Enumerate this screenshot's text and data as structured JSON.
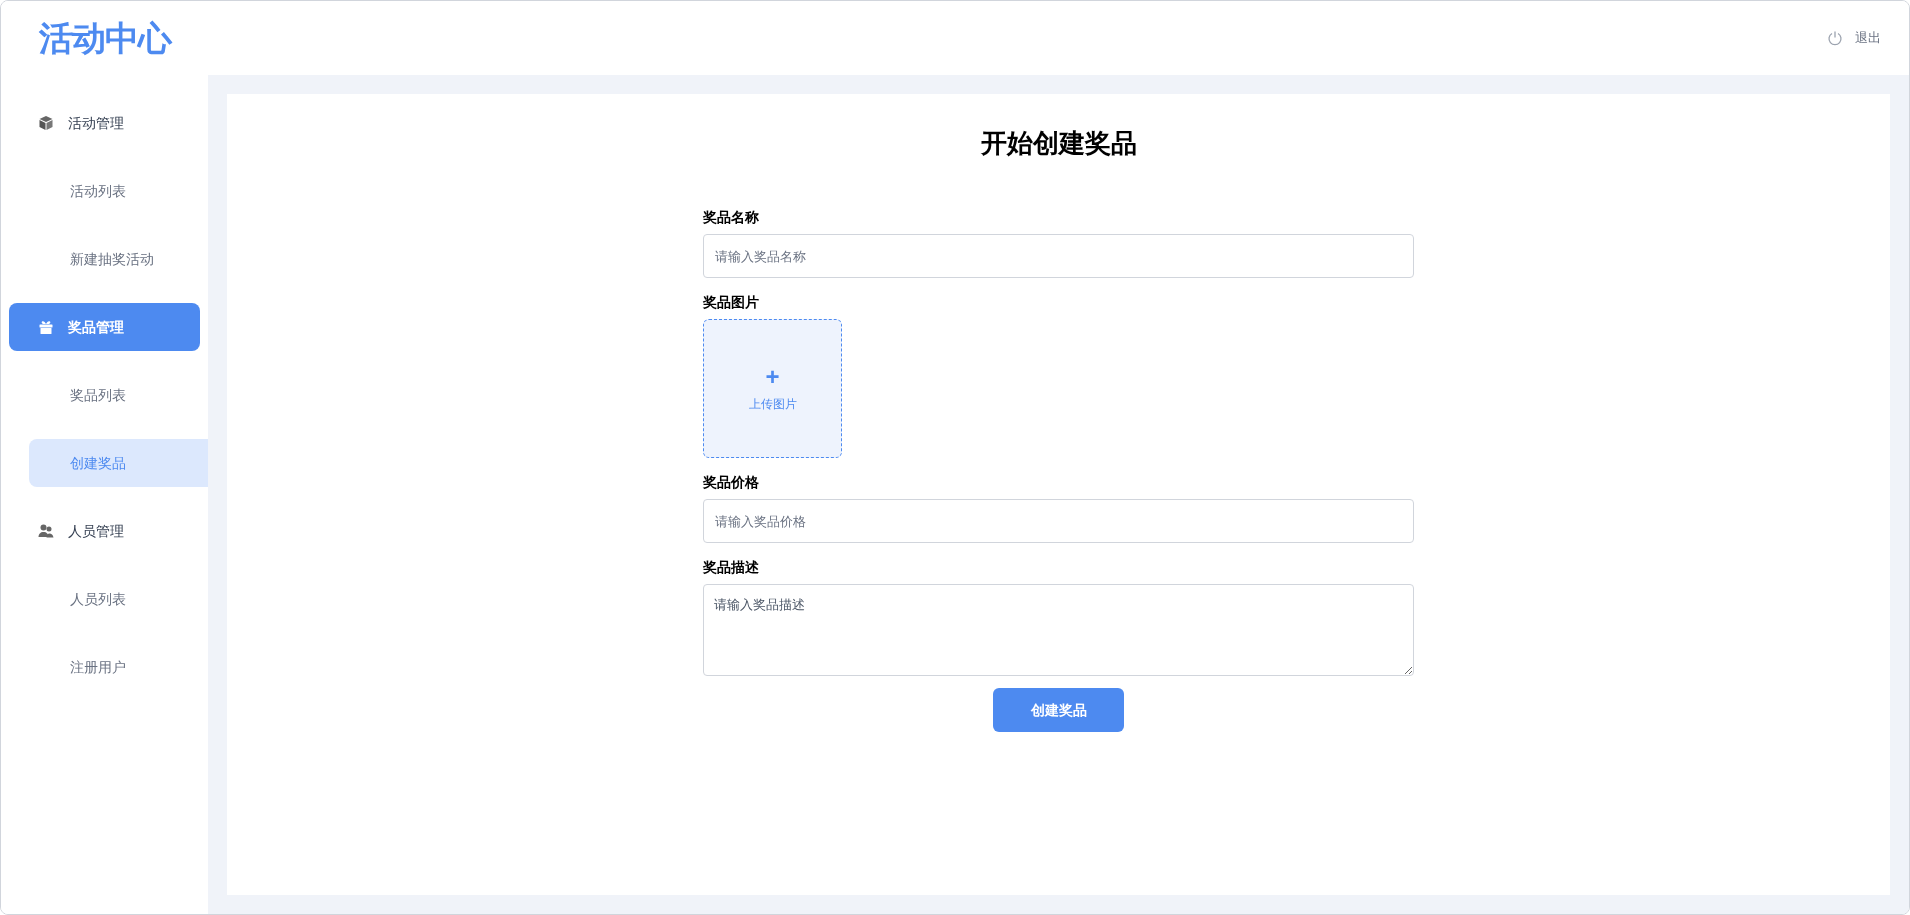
{
  "logo": "活动中心",
  "header": {
    "logout": "退出"
  },
  "sidebar": {
    "groups": [
      {
        "label": "活动管理",
        "selected": false,
        "children": [
          {
            "label": "活动列表",
            "selected": false
          },
          {
            "label": "新建抽奖活动",
            "selected": false
          }
        ]
      },
      {
        "label": "奖品管理",
        "selected": true,
        "children": [
          {
            "label": "奖品列表",
            "selected": false
          },
          {
            "label": "创建奖品",
            "selected": true
          }
        ]
      },
      {
        "label": "人员管理",
        "selected": false,
        "children": [
          {
            "label": "人员列表",
            "selected": false
          },
          {
            "label": "注册用户",
            "selected": false
          }
        ]
      }
    ]
  },
  "form": {
    "title": "开始创建奖品",
    "fields": [
      {
        "kind": "text",
        "label": "奖品名称",
        "placeholder": "请输入奖品名称"
      },
      {
        "kind": "upload",
        "label": "奖品图片",
        "icon": "+",
        "text": "上传图片"
      },
      {
        "kind": "text",
        "label": "奖品价格",
        "placeholder": "请输入奖品价格"
      },
      {
        "kind": "textarea",
        "label": "奖品描述",
        "placeholder": "请输入奖品描述"
      }
    ],
    "submit": "创建奖品"
  }
}
